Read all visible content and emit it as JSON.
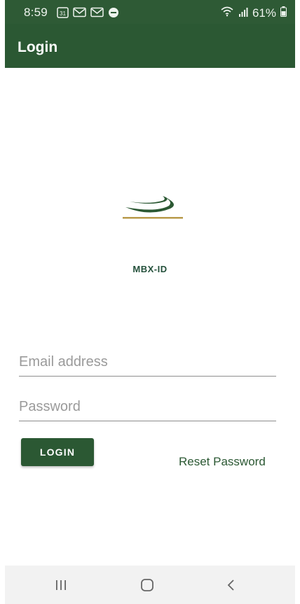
{
  "status_bar": {
    "time": "8:59",
    "calendar_day": "31",
    "battery_percent": "61%"
  },
  "app_bar": {
    "title": "Login"
  },
  "branding": {
    "app_name": "MBX-ID"
  },
  "form": {
    "email_placeholder": "Email address",
    "email_value": "",
    "password_placeholder": "Password",
    "password_value": "",
    "login_label": "LOGIN",
    "reset_label": "Reset Password"
  },
  "nav_bar": {
    "icons": [
      "recent-apps-icon",
      "home-icon",
      "back-icon"
    ]
  },
  "colors": {
    "primary": "#2b5833",
    "status_bar": "#2e5a35",
    "logo_gold": "#b89a4a",
    "text_link": "#2b5833"
  }
}
